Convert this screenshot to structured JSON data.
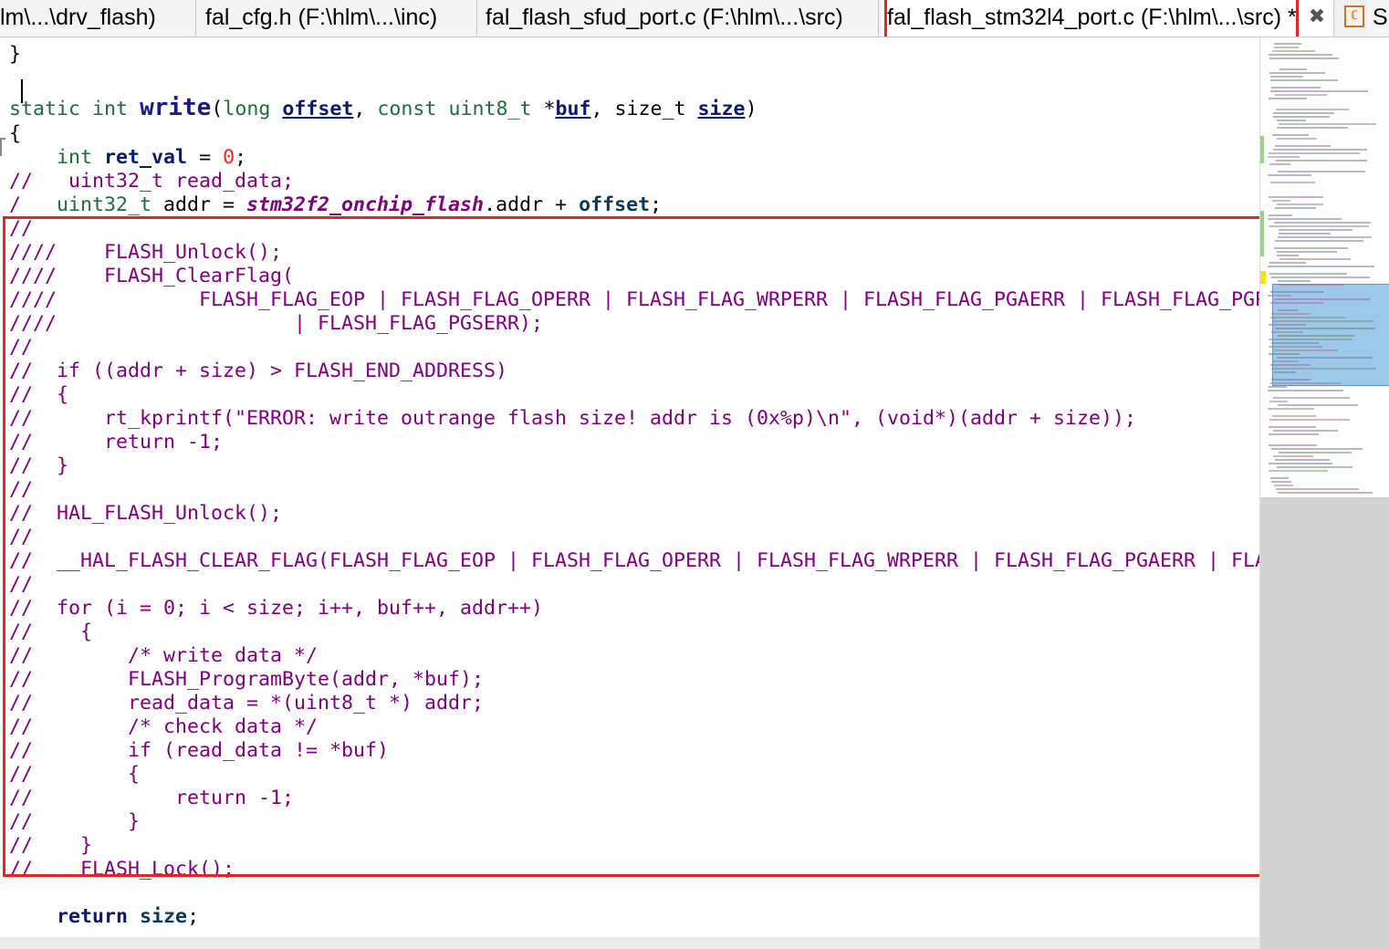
{
  "tabs": [
    {
      "label": "lm\\...\\drv_flash)",
      "active": false
    },
    {
      "label": "fal_cfg.h (F:\\hlm\\...\\inc)",
      "active": false
    },
    {
      "label": "fal_flash_sfud_port.c (F:\\hlm\\...\\src)",
      "active": false
    },
    {
      "label": "fal_flash_stm32l4_port.c (F:\\hlm\\...\\src) *",
      "active": true
    },
    {
      "label": "S",
      "active": false
    }
  ],
  "tab_close_glyph": "✖",
  "tab_file_icon_glyph": "ℂ",
  "code": {
    "l0": {
      "brace": "}"
    },
    "l1": {
      "static": "static",
      "int": "int",
      "name": "write",
      "open": "(",
      "long": "long",
      "offset": "offset",
      "c1": ", ",
      "const": "const",
      "uint8": "uint8_t",
      "star": " *",
      "buf": "buf",
      "c2": ", ",
      "sizet": "size_t",
      "size": "size",
      "close": ")"
    },
    "l2": {
      "brace": "{"
    },
    "l3": {
      "indent": "    ",
      "int": "int",
      "var": "ret_val",
      "eq": " = ",
      "zero": "0",
      "semi": ";"
    },
    "l4": {
      "text": "//   uint32_t read_data;"
    },
    "l5": {
      "slash": "/   ",
      "type": "uint32_t",
      "mid": " addr = ",
      "glob": "stm32f2_onchip_flash",
      "dot": ".addr + ",
      "offset": "offset",
      "semi": ";"
    },
    "comments": [
      "//",
      "////    FLASH_Unlock();",
      "////    FLASH_ClearFlag(",
      "////            FLASH_FLAG_EOP | FLASH_FLAG_OPERR | FLASH_FLAG_WRPERR | FLASH_FLAG_PGAERR | FLASH_FLAG_PGPERR",
      "////                    | FLASH_FLAG_PGSERR);",
      "//",
      "//  if ((addr + size) > FLASH_END_ADDRESS)",
      "//  {",
      "//      rt_kprintf(\"ERROR: write outrange flash size! addr is (0x%p)\\n\", (void*)(addr + size));",
      "//      return -1;",
      "//  }",
      "//",
      "//  HAL_FLASH_Unlock();",
      "//",
      "//  __HAL_FLASH_CLEAR_FLAG(FLASH_FLAG_EOP | FLASH_FLAG_OPERR | FLASH_FLAG_WRPERR | FLASH_FLAG_PGAERR | FLASH_FLAG_PGPERR);",
      "//",
      "//  for (i = 0; i < size; i++, buf++, addr++)",
      "//    {",
      "//        /* write data */",
      "//        FLASH_ProgramByte(addr, *buf);",
      "//        read_data = *(uint8_t *) addr;",
      "//        /* check data */",
      "//        if (read_data != *buf)",
      "//        {",
      "//            return -1;",
      "//        }",
      "//    }",
      "//    FLASH_Lock();"
    ],
    "blank_after": "",
    "ret": {
      "indent": "    ",
      "kw": "return",
      "sp": " ",
      "size": "size",
      "semi": ";"
    }
  },
  "colors": {
    "highlight": "#e5261f",
    "comment": "#800080",
    "keyword": "#1a6e3a",
    "number": "#ff2020",
    "minimap_viewport": "#9cc8ea"
  }
}
